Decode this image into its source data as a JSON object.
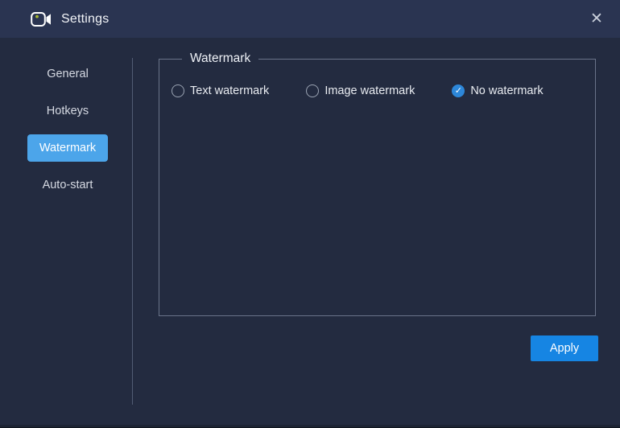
{
  "window": {
    "title": "Settings",
    "close_glyph": "✕"
  },
  "sidebar": {
    "items": [
      {
        "label": "General",
        "selected": false
      },
      {
        "label": "Hotkeys",
        "selected": false
      },
      {
        "label": "Watermark",
        "selected": true
      },
      {
        "label": "Auto-start",
        "selected": false
      }
    ]
  },
  "panel": {
    "legend": "Watermark",
    "options": [
      {
        "label": "Text watermark",
        "selected": false
      },
      {
        "label": "Image watermark",
        "selected": false
      },
      {
        "label": "No watermark",
        "selected": true
      }
    ],
    "apply_label": "Apply"
  },
  "icons": {
    "check_glyph": "✓",
    "camera_icon": "video-camera"
  },
  "colors": {
    "titlebar_bg": "#2a3451",
    "body_bg": "#232b40",
    "sidebar_selected_bg": "#4ca5ea",
    "apply_button_bg": "#1685e3",
    "checked_option_bg": "#2d87d9",
    "camera_dot": "#a9b92e"
  }
}
